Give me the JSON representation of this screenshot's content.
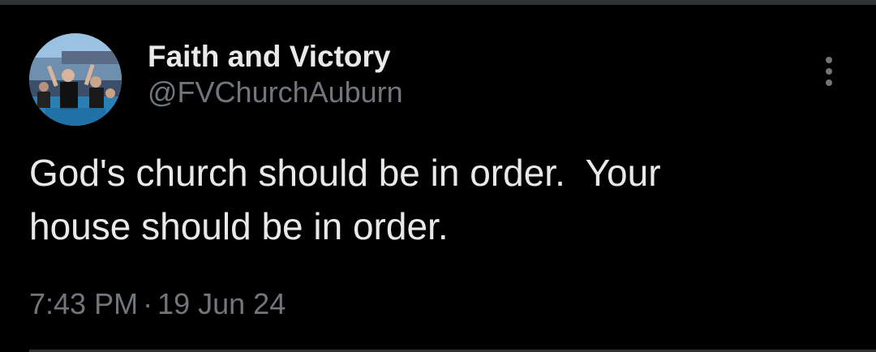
{
  "tweet": {
    "author": {
      "display_name": "Faith and Victory",
      "handle": "@FVChurchAuburn",
      "avatar_icon": "profile-photo"
    },
    "text": "God's church should be in order.  Your\nhouse should be in order.",
    "time": "7:43 PM",
    "separator": "·",
    "date": "19 Jun 24",
    "more_icon": "more-vertical-icon"
  },
  "colors": {
    "background": "#000000",
    "primary_text": "#e7e9ea",
    "secondary_text": "#71767b",
    "divider": "#2f3336"
  }
}
